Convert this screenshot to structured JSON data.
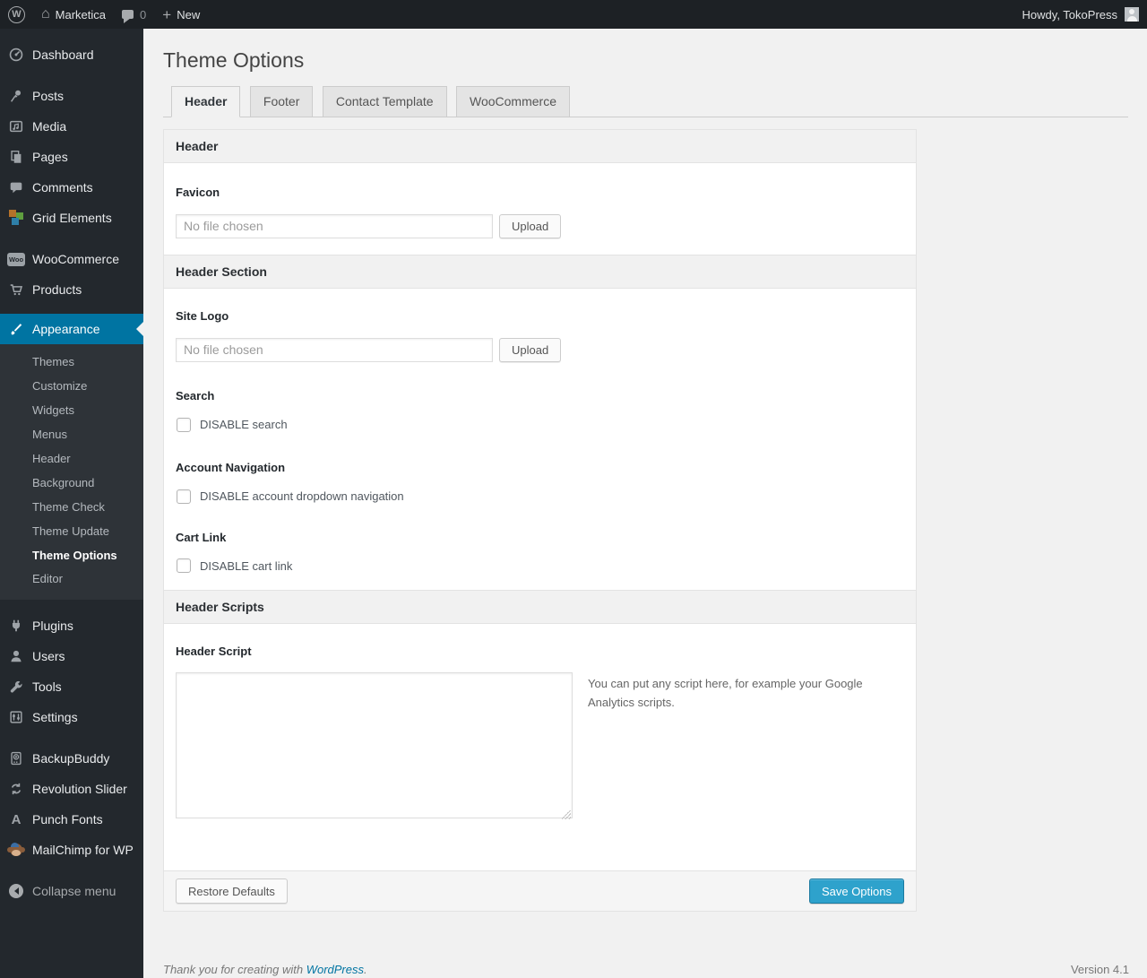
{
  "admin_bar": {
    "site_name": "Marketica",
    "comments_count": "0",
    "new_label": "New",
    "howdy": "Howdy, TokoPress"
  },
  "sidebar": {
    "dashboard": "Dashboard",
    "posts": "Posts",
    "media": "Media",
    "pages": "Pages",
    "comments": "Comments",
    "grid_elements": "Grid Elements",
    "woocommerce": "WooCommerce",
    "products": "Products",
    "appearance": "Appearance",
    "appearance_submenu": {
      "themes": "Themes",
      "customize": "Customize",
      "widgets": "Widgets",
      "menus": "Menus",
      "header": "Header",
      "background": "Background",
      "theme_check": "Theme Check",
      "theme_update": "Theme Update",
      "theme_options": "Theme Options",
      "editor": "Editor"
    },
    "plugins": "Plugins",
    "users": "Users",
    "tools": "Tools",
    "settings": "Settings",
    "backupbuddy": "BackupBuddy",
    "revolution_slider": "Revolution Slider",
    "punch_fonts": "Punch Fonts",
    "mailchimp": "MailChimp for WP",
    "collapse": "Collapse menu"
  },
  "page": {
    "title": "Theme Options"
  },
  "tabs": {
    "header": "Header",
    "footer": "Footer",
    "contact_template": "Contact Template",
    "woocommerce": "WooCommerce"
  },
  "panel": {
    "sections": {
      "header": "Header",
      "header_section": "Header Section",
      "header_scripts": "Header Scripts"
    },
    "favicon": {
      "label": "Favicon",
      "placeholder": "No file chosen",
      "button": "Upload"
    },
    "site_logo": {
      "label": "Site Logo",
      "placeholder": "No file chosen",
      "button": "Upload"
    },
    "search": {
      "label": "Search",
      "checkbox": "DISABLE search"
    },
    "account_navigation": {
      "label": "Account Navigation",
      "checkbox": "DISABLE account dropdown navigation"
    },
    "cart_link": {
      "label": "Cart Link",
      "checkbox": "DISABLE cart link"
    },
    "header_script": {
      "label": "Header Script",
      "value": "",
      "note": "You can put any script here, for example your Google Analytics scripts."
    },
    "footer_actions": {
      "restore": "Restore Defaults",
      "save": "Save Options"
    }
  },
  "page_footer": {
    "thanks_prefix": "Thank you for creating with ",
    "link": "WordPress",
    "suffix": ".",
    "version": "Version 4.1"
  },
  "colors": {
    "accent": "#0074a2",
    "primary_button": "#2ea2cc",
    "menu_bg": "#23282d",
    "page_bg": "#f1f1f1",
    "link": "#0074a2"
  }
}
